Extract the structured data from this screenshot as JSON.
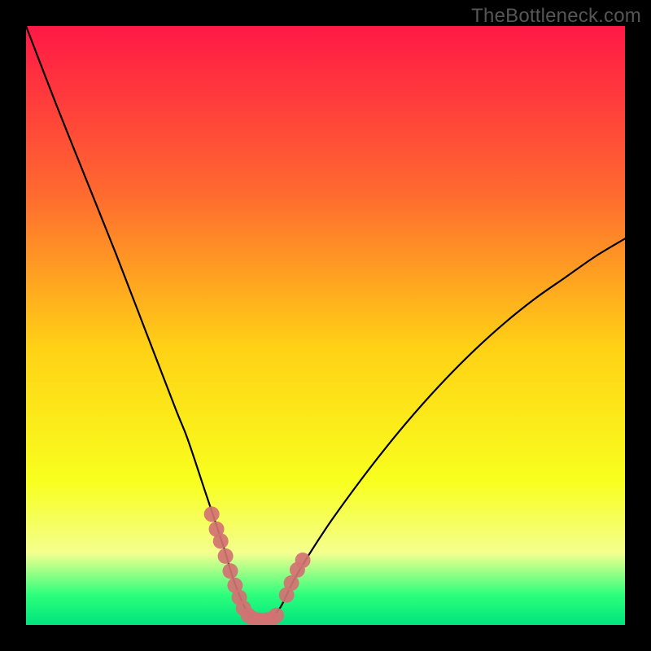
{
  "watermark": "TheBottleneck.com",
  "gradient": {
    "top": "#ff1846",
    "q1": "#ff6a2f",
    "mid": "#ffd215",
    "q3": "#f8ff1e",
    "band": "#f4ff8f",
    "low": "#2dff7c",
    "bottom": "#00e37d"
  },
  "curve_color": "#000000",
  "marker_color": "#d37272",
  "chart_data": {
    "type": "line",
    "title": "",
    "xlabel": "",
    "ylabel": "",
    "xlim": [
      0,
      100
    ],
    "ylim": [
      0,
      100
    ],
    "series": [
      {
        "name": "bottleneck_curve",
        "x": [
          0,
          5,
          10,
          15,
          20,
          25,
          27,
          30,
          33,
          34.5,
          36.5,
          38.5,
          40.5,
          42.5,
          45,
          50,
          55,
          60,
          65,
          70,
          75,
          80,
          85,
          90,
          95,
          100
        ],
        "y": [
          100,
          87,
          74.5,
          62,
          49,
          36,
          31,
          22,
          13,
          8,
          3,
          1,
          1,
          3,
          8,
          16,
          23,
          29.5,
          35.5,
          41,
          46,
          50.5,
          54.5,
          58,
          61.5,
          64.5
        ]
      }
    ],
    "markers": {
      "name": "bottom_highlight",
      "points": [
        {
          "x": 31,
          "y": 18.5
        },
        {
          "x": 31.8,
          "y": 16
        },
        {
          "x": 32.5,
          "y": 14
        },
        {
          "x": 33.3,
          "y": 11.5
        },
        {
          "x": 34.1,
          "y": 9
        },
        {
          "x": 34.9,
          "y": 6.6
        },
        {
          "x": 35.6,
          "y": 4.6
        },
        {
          "x": 36.3,
          "y": 2.8
        },
        {
          "x": 37.1,
          "y": 1.6
        },
        {
          "x": 38.0,
          "y": 1.0
        },
        {
          "x": 39.0,
          "y": 0.8
        },
        {
          "x": 40.0,
          "y": 0.8
        },
        {
          "x": 41.0,
          "y": 1.0
        },
        {
          "x": 41.8,
          "y": 1.6
        },
        {
          "x": 43.5,
          "y": 5.0
        },
        {
          "x": 44.3,
          "y": 7.0
        },
        {
          "x": 45.3,
          "y": 9.2
        },
        {
          "x": 46.2,
          "y": 10.8
        }
      ]
    }
  }
}
